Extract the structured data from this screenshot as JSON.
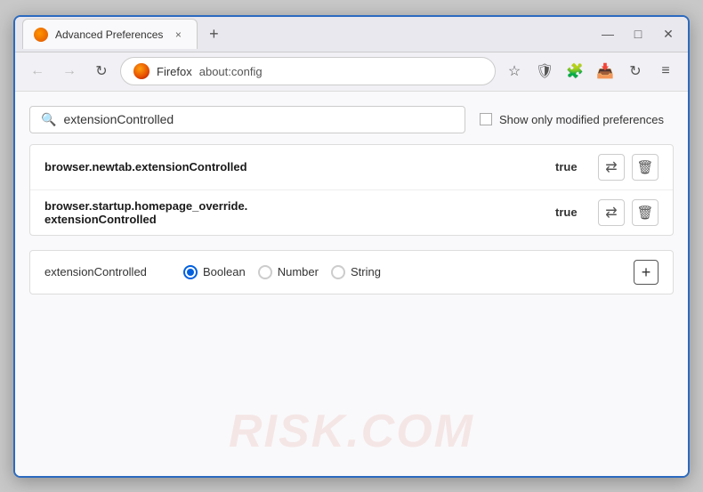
{
  "window": {
    "title": "Advanced Preferences",
    "tab_close_label": "×",
    "new_tab_label": "+"
  },
  "window_controls": {
    "minimize": "—",
    "maximize": "□",
    "close": "✕"
  },
  "nav": {
    "back_title": "Back",
    "forward_title": "Forward",
    "reload_title": "Reload",
    "browser_name": "Firefox",
    "url": "about:config",
    "star_title": "Bookmark",
    "shield_title": "Shield",
    "extension_title": "Extension",
    "pocket_title": "Pocket",
    "sync_title": "Sync",
    "menu_title": "Menu"
  },
  "search": {
    "placeholder": "extensionControlled",
    "value": "extensionControlled",
    "show_modified_label": "Show only modified preferences"
  },
  "results": [
    {
      "name": "browser.newtab.extensionControlled",
      "value": "true",
      "multiline": false
    },
    {
      "name_line1": "browser.startup.homepage_override.",
      "name_line2": "extensionControlled",
      "value": "true",
      "multiline": true
    }
  ],
  "add_pref": {
    "name": "extensionControlled",
    "type_options": [
      {
        "label": "Boolean",
        "selected": true
      },
      {
        "label": "Number",
        "selected": false
      },
      {
        "label": "String",
        "selected": false
      }
    ],
    "add_label": "+"
  },
  "watermark": "RISK.COM",
  "icons": {
    "search": "🔍",
    "star": "☆",
    "swap": "⇄",
    "trash": "🗑",
    "menu": "≡",
    "back": "←",
    "forward": "→",
    "reload": "↻"
  }
}
